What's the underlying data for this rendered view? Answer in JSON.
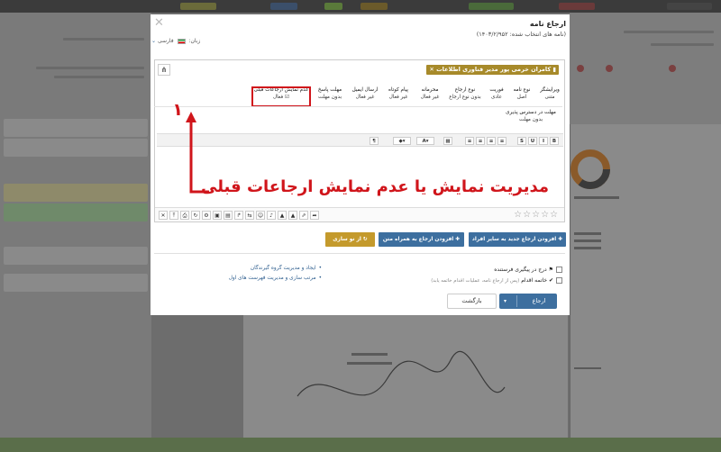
{
  "modal": {
    "title": "ارجاع نامه",
    "subtitle": "(نامه های انتخاب شده: ۱۴۰۳/۲/۹۵۲)",
    "language_label": "زبان:",
    "language_value": "فارسی",
    "recipient": "کامران خرمی پور مدیر فناوری اطلاعات",
    "options": [
      {
        "label": "ویرایشگر",
        "value": "متنی"
      },
      {
        "label": "نوع نامه",
        "value": "اصل"
      },
      {
        "label": "فوریت",
        "value": "عادی"
      },
      {
        "label": "نوع ارجاع",
        "value": "بدون نوع ارجاع"
      },
      {
        "label": "محرمانه",
        "value": "غیر فعال"
      },
      {
        "label": "پیام کوتاه",
        "value": "غیر فعال"
      },
      {
        "label": "ارسال ایمیل",
        "value": "غیر فعال"
      },
      {
        "label": "مهلت پاسخ",
        "value": "بدون مهلت"
      },
      {
        "label": "عدم نمایش ارجاعات قبلی",
        "value": "فعال"
      },
      {
        "label": "مهلت در دسترس پذیری",
        "value": "بدون مهلت"
      }
    ],
    "format_buttons": [
      "B",
      "I",
      "U",
      "S",
      "≡",
      "≡",
      "≡",
      "≡",
      "▦",
      "A",
      "◆",
      "¶"
    ],
    "annotation_number": "۱",
    "annotation_text": "مدیریت نمایش یا عدم نمایش ارجاعات قبلی",
    "stars": "☆☆☆☆☆",
    "buttons": {
      "add_to_others": "افزودن ارجاع جدید به سایر افراد",
      "add_with_text": "افزودن ارجاع به همراه متن",
      "from_scratch": "از نو سازی"
    },
    "checks": {
      "track": "درج در پیگیری فرستنده",
      "finish": "خاتمه اقدام",
      "finish_note": "(پس از ارجاع نامه، عملیات اقدام خاتمه یابد)"
    },
    "links": [
      "ایجاد و مدیریت گروه گیرندگان",
      "مرتب سازی و مدیریت فهرست های اول"
    ],
    "send_label": "ارجاع",
    "back_label": "بازگشت"
  },
  "colors": {
    "accent_red": "#d0151b",
    "primary_blue": "#3d6f9f",
    "gold": "#c49a2c"
  }
}
